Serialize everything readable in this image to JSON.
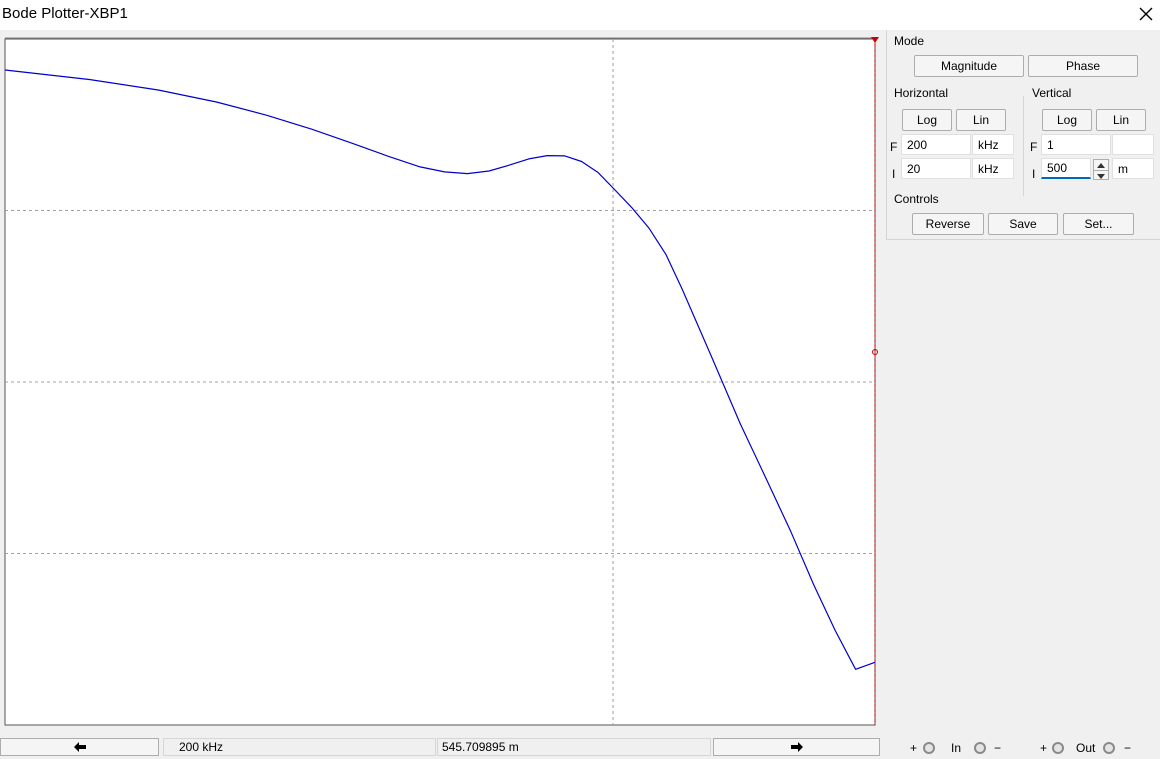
{
  "window": {
    "title": "Bode Plotter-XBP1",
    "close_icon": "close-icon"
  },
  "colors": {
    "trace": "#0000cc",
    "cursor": "#cc0000",
    "grid": "#a0a0a0",
    "plot_bg": "#ffffff",
    "active_field": "#0067c0"
  },
  "mode": {
    "label": "Mode",
    "magnitude_label": "Magnitude",
    "phase_label": "Phase"
  },
  "horizontal": {
    "label": "Horizontal",
    "log_label": "Log",
    "lin_label": "Lin",
    "final_letter": "F",
    "final_value": "200",
    "final_unit": "kHz",
    "initial_letter": "I",
    "initial_value": "20",
    "initial_unit": "kHz"
  },
  "vertical": {
    "label": "Vertical",
    "log_label": "Log",
    "lin_label": "Lin",
    "final_letter": "F",
    "final_value": "1",
    "final_unit": "",
    "initial_letter": "I",
    "initial_value": "500",
    "initial_unit": "m"
  },
  "controls": {
    "label": "Controls",
    "reverse_label": "Reverse",
    "save_label": "Save",
    "set_label": "Set..."
  },
  "status": {
    "frequency": "200 kHz",
    "value": "545.709895 m"
  },
  "terminals": {
    "in_plus": "+",
    "in_label": "In",
    "in_minus": "−",
    "out_plus": "+",
    "out_label": "Out",
    "out_minus": "−"
  },
  "chart_data": {
    "type": "line",
    "x_scale": "log",
    "y_scale": "lin",
    "xlim": [
      20,
      200
    ],
    "x_unit": "kHz",
    "ylim": [
      0.5,
      1.0
    ],
    "grid": true,
    "series": [
      {
        "points": [
          [
            20,
            0.9774
          ],
          [
            25,
            0.9705
          ],
          [
            30,
            0.9628
          ],
          [
            35,
            0.9541
          ],
          [
            40,
            0.9444
          ],
          [
            45,
            0.9343
          ],
          [
            50,
            0.9243
          ],
          [
            55,
            0.9148
          ],
          [
            60,
            0.9068
          ],
          [
            64,
            0.9031
          ],
          [
            68,
            0.9019
          ],
          [
            72,
            0.9038
          ],
          [
            76,
            0.9081
          ],
          [
            80,
            0.9126
          ],
          [
            84,
            0.915
          ],
          [
            88,
            0.9148
          ],
          [
            92,
            0.9107
          ],
          [
            96,
            0.9029
          ],
          [
            100,
            0.8914
          ],
          [
            105,
            0.8773
          ],
          [
            110,
            0.862
          ],
          [
            115,
            0.843
          ],
          [
            120,
            0.818
          ],
          [
            130,
            0.7673
          ],
          [
            140,
            0.7197
          ],
          [
            150,
            0.6793
          ],
          [
            160,
            0.6412
          ],
          [
            170,
            0.6024
          ],
          [
            180,
            0.5689
          ],
          [
            190,
            0.5406
          ],
          [
            200,
            0.5457
          ]
        ]
      }
    ],
    "cursor": {
      "x": 200,
      "y": 545.709895,
      "y_unit": "m"
    }
  }
}
